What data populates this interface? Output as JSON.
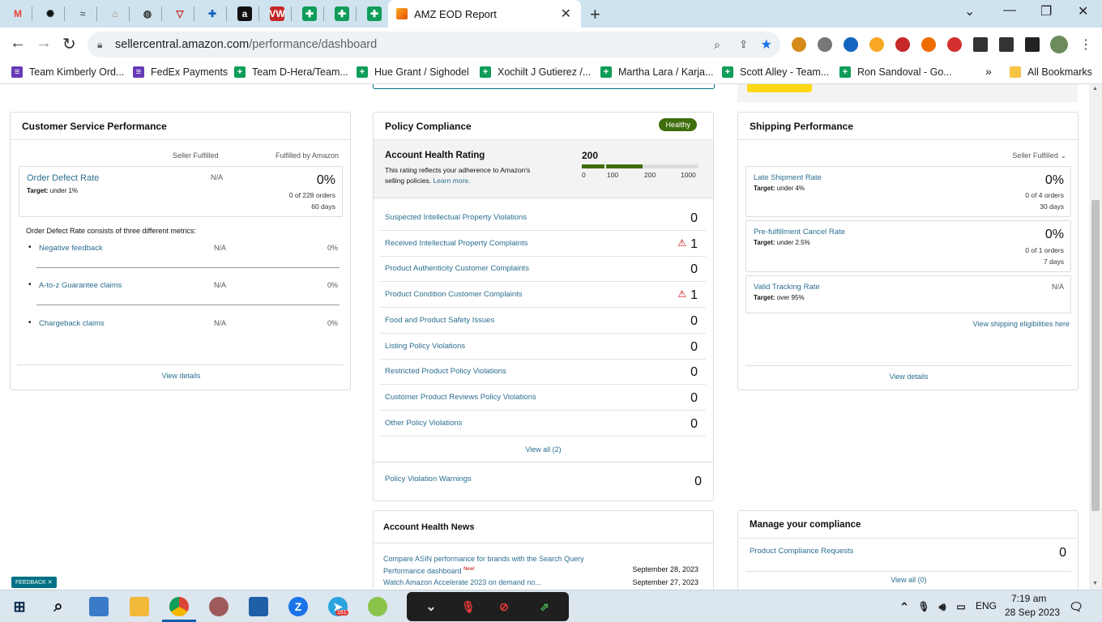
{
  "browser": {
    "tabs": [
      {
        "icon": "gmail-icon",
        "glyph": "M"
      },
      {
        "icon": "chatgpt-icon",
        "glyph": "✺"
      },
      {
        "icon": "tool-icon",
        "glyph": "≈"
      },
      {
        "icon": "tool-icon-2",
        "glyph": "⌂"
      },
      {
        "icon": "globe-icon",
        "glyph": "◍"
      },
      {
        "icon": "helium-icon",
        "glyph": "▽"
      },
      {
        "icon": "keepa-icon",
        "glyph": "✚"
      },
      {
        "icon": "amazon-icon",
        "glyph": "a"
      },
      {
        "icon": "vw-icon",
        "glyph": "VW"
      },
      {
        "icon": "sheets-icon",
        "glyph": "✚"
      },
      {
        "icon": "sheets-icon",
        "glyph": "✚"
      },
      {
        "icon": "sheets-icon",
        "glyph": "✚"
      }
    ],
    "active_tab": {
      "title": "AMZ EOD Report"
    },
    "url_host": "sellercentral.amazon.com",
    "url_path": "/performance/dashboard",
    "bookmarks": [
      {
        "label": "Team Kimberly Ord..."
      },
      {
        "label": "FedEx Payments"
      },
      {
        "label": "Team D-Hera/Team..."
      },
      {
        "label": "Hue Grant / Sighodel"
      },
      {
        "label": "Xochilt J Gutierez /..."
      },
      {
        "label": "Martha Lara / Karja..."
      },
      {
        "label": "Scott Alley - Team..."
      },
      {
        "label": "Ron Sandoval - Go..."
      }
    ],
    "all_bookmarks": "All Bookmarks",
    "more_glyph": "»"
  },
  "csp": {
    "title": "Customer Service Performance",
    "col_seller": "Seller Fulfilled",
    "col_fba": "Fulfilled by Amazon",
    "odr_label": "Order Defect Rate",
    "odr_target_label": "Target:",
    "odr_target": "under 1%",
    "odr_seller": "N/A",
    "odr_value": "0%",
    "odr_orders": "0 of 228 orders",
    "odr_days": "60 days",
    "consists": "Order Defect Rate consists of three different metrics:",
    "metrics": [
      {
        "label": "Negative feedback",
        "seller": "N/A",
        "fba": "0%"
      },
      {
        "label": "A-to-z Guarantee claims",
        "seller": "N/A",
        "fba": "0%"
      },
      {
        "label": "Chargeback claims",
        "seller": "N/A",
        "fba": "0%"
      }
    ],
    "view_details": "View details"
  },
  "policy": {
    "title": "Policy Compliance",
    "badge": "Healthy",
    "ahr_title": "Account Health Rating",
    "ahr_desc1": "This rating reflects your adherence to Amazon's",
    "ahr_desc2": "selling policies.",
    "learn_more": "Learn more.",
    "ahr_value": "200",
    "ahr_level": 0.2,
    "ahr_ticks": [
      "0",
      "100",
      "200",
      "1000"
    ],
    "rows": [
      {
        "label": "Suspected Intellectual Property Violations",
        "value": "0",
        "warn": false
      },
      {
        "label": "Received Intellectual Property Complaints",
        "value": "1",
        "warn": true
      },
      {
        "label": "Product Authenticity Customer Complaints",
        "value": "0",
        "warn": false
      },
      {
        "label": "Product Condition Customer Complaints",
        "value": "1",
        "warn": true
      },
      {
        "label": "Food and Product Safety Issues",
        "value": "0",
        "warn": false
      },
      {
        "label": "Listing Policy Violations",
        "value": "0",
        "warn": false
      },
      {
        "label": "Restricted Product Policy Violations",
        "value": "0",
        "warn": false
      },
      {
        "label": "Customer Product Reviews Policy Violations",
        "value": "0",
        "warn": false
      },
      {
        "label": "Other Policy Violations",
        "value": "0",
        "warn": false
      }
    ],
    "view_all": "View all (2)",
    "warnings_label": "Policy Violation Warnings",
    "warnings_value": "0"
  },
  "shipping": {
    "title": "Shipping Performance",
    "filter": "Seller Fulfilled",
    "late_label": "Late Shipment Rate",
    "late_target": "under 4%",
    "late_value": "0%",
    "late_orders": "0 of 4 orders",
    "late_days": "30 days",
    "cancel_label": "Pre-fulfillment Cancel Rate",
    "cancel_target": "under 2.5%",
    "cancel_value": "0%",
    "cancel_orders": "0 of 1 orders",
    "cancel_days": "7 days",
    "vtr_label": "Valid Tracking Rate",
    "vtr_target": "over 95%",
    "vtr_value": "N/A",
    "eligibilities": "View shipping eligibilities here",
    "view_details": "View details"
  },
  "news": {
    "title": "Account Health News",
    "items": [
      {
        "text1": "Compare ASIN performance for brands with the Search Query",
        "text2": "Performance dashboard",
        "new": "New!",
        "date": "September 28, 2023"
      },
      {
        "text1": "Watch Amazon Accelerate 2023 on demand no...",
        "date": "September 27, 2023"
      }
    ]
  },
  "compliance": {
    "title": "Manage your compliance",
    "req_label": "Product Compliance Requests",
    "req_value": "0",
    "view_all": "View all (0)"
  },
  "feedback": "FEEDBACK",
  "target_word": "Target:",
  "taskbar": {
    "lang": "ENG",
    "time": "7:19 am",
    "date": "28 Sep 2023",
    "telegram_badge": "161"
  },
  "colors": {
    "accent": "#007185",
    "link": "#2b6e8f",
    "healthy": "#3f6e0c",
    "bar_green": "#3f6e0c",
    "warning": "#c40000"
  }
}
